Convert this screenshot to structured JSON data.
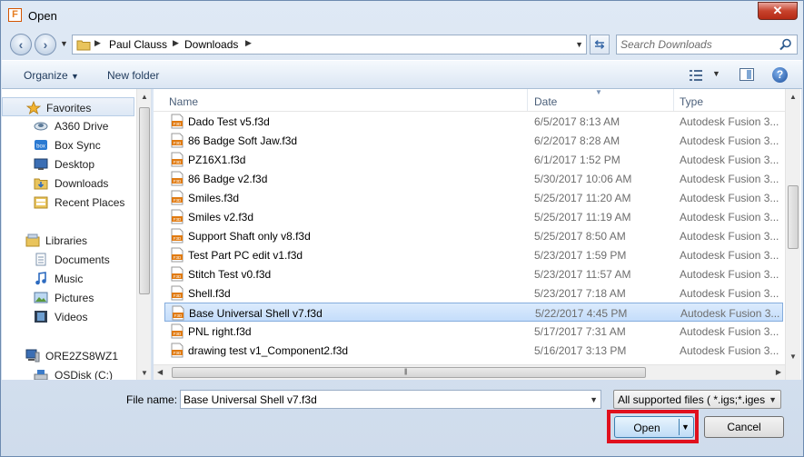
{
  "window": {
    "title": "Open",
    "app_icon": "F",
    "close_label": "✕"
  },
  "address": {
    "crumbs": [
      "Paul Clauss",
      "Downloads"
    ],
    "search_placeholder": "Search Downloads"
  },
  "toolbar": {
    "organize": "Organize",
    "new_folder": "New folder",
    "help": "?"
  },
  "navpane": {
    "favorites": "Favorites",
    "favorite_items": [
      "A360 Drive",
      "Box Sync",
      "Desktop",
      "Downloads",
      "Recent Places"
    ],
    "libraries": "Libraries",
    "library_items": [
      "Documents",
      "Music",
      "Pictures",
      "Videos"
    ],
    "computer": "ORE2ZS8WZ1",
    "computer_items": [
      "OSDisk (C:)"
    ]
  },
  "columns": {
    "name": "Name",
    "date": "Date",
    "type": "Type"
  },
  "files": [
    {
      "name": "Dado Test v5.f3d",
      "date": "6/5/2017 8:13 AM",
      "type": "Autodesk Fusion 3..."
    },
    {
      "name": "86 Badge Soft Jaw.f3d",
      "date": "6/2/2017 8:28 AM",
      "type": "Autodesk Fusion 3..."
    },
    {
      "name": "PZ16X1.f3d",
      "date": "6/1/2017 1:52 PM",
      "type": "Autodesk Fusion 3..."
    },
    {
      "name": "86 Badge v2.f3d",
      "date": "5/30/2017 10:06 AM",
      "type": "Autodesk Fusion 3..."
    },
    {
      "name": "Smiles.f3d",
      "date": "5/25/2017 11:20 AM",
      "type": "Autodesk Fusion 3..."
    },
    {
      "name": "Smiles v2.f3d",
      "date": "5/25/2017 11:19 AM",
      "type": "Autodesk Fusion 3..."
    },
    {
      "name": "Support Shaft only v8.f3d",
      "date": "5/25/2017 8:50 AM",
      "type": "Autodesk Fusion 3..."
    },
    {
      "name": "Test Part PC edit v1.f3d",
      "date": "5/23/2017 1:59 PM",
      "type": "Autodesk Fusion 3..."
    },
    {
      "name": "Stitch Test v0.f3d",
      "date": "5/23/2017 11:57 AM",
      "type": "Autodesk Fusion 3..."
    },
    {
      "name": "Shell.f3d",
      "date": "5/23/2017 7:18 AM",
      "type": "Autodesk Fusion 3..."
    },
    {
      "name": "Base Universal Shell v7.f3d",
      "date": "5/22/2017 4:45 PM",
      "type": "Autodesk Fusion 3..."
    },
    {
      "name": "PNL right.f3d",
      "date": "5/17/2017 7:31 AM",
      "type": "Autodesk Fusion 3..."
    },
    {
      "name": "drawing test v1_Component2.f3d",
      "date": "5/16/2017 3:13 PM",
      "type": "Autodesk Fusion 3..."
    }
  ],
  "selected_index": 10,
  "footer": {
    "filename_label": "File name:",
    "filename_value": "Base Universal Shell v7.f3d",
    "filter_label": "All supported files ( *.igs;*.iges;",
    "open": "Open",
    "cancel": "Cancel"
  },
  "colors": {
    "highlight": "#e0101d",
    "selection": "#c4ddfb"
  }
}
